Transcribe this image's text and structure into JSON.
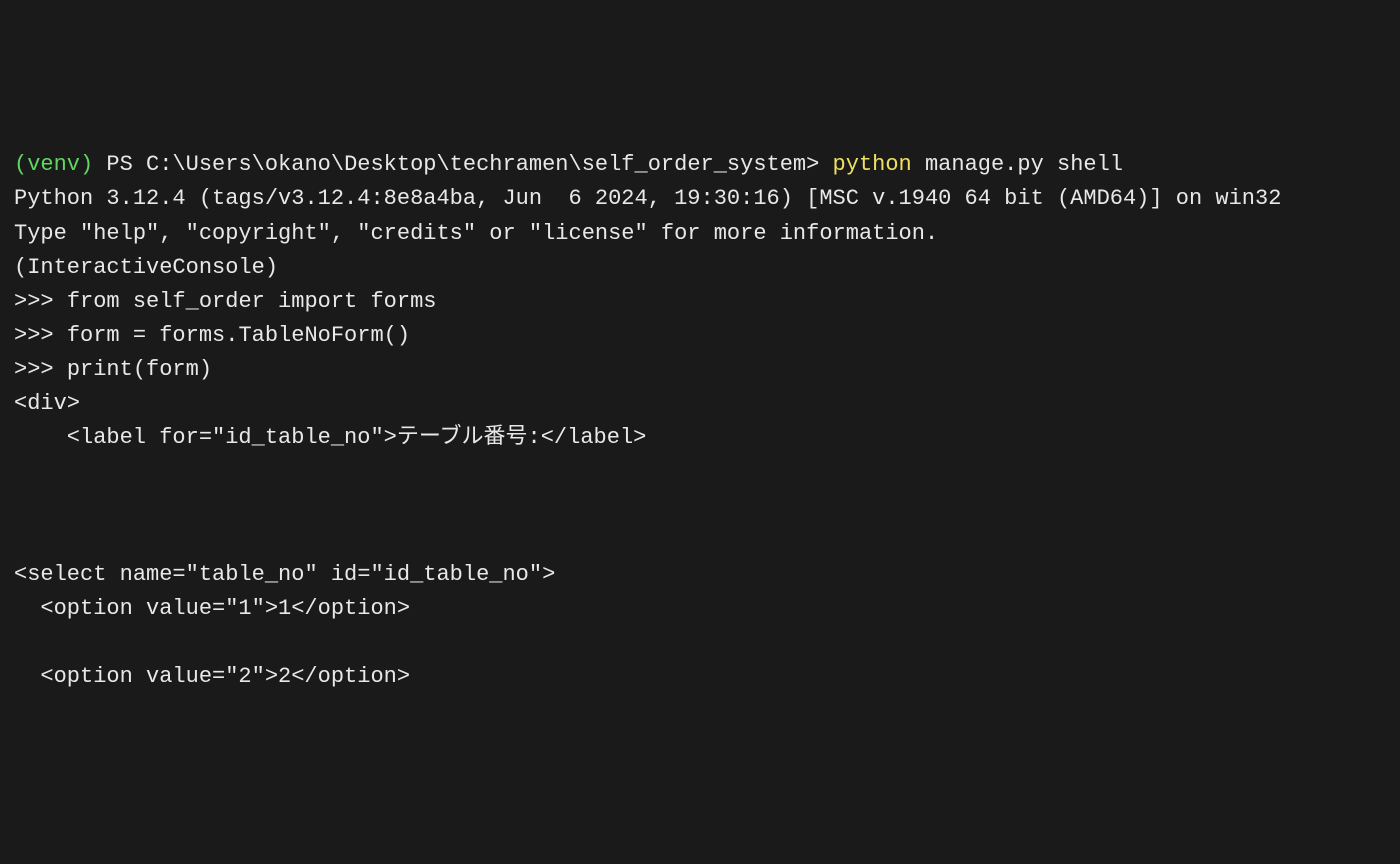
{
  "prompt": {
    "venv": "(venv)",
    "shell_prefix": " PS ",
    "path": "C:\\Users\\okano\\Desktop\\techramen\\self_order_system",
    "chevron": "> ",
    "command_py": "python",
    "command_args": " manage.py shell"
  },
  "header": {
    "python_version": "Python 3.12.4 (tags/v3.12.4:8e8a4ba, Jun  6 2024, 19:30:16) [MSC v.1940 64 bit (AMD64)] on win32",
    "help_line": "Type \"help\", \"copyright\", \"credits\" or \"license\" for more information.",
    "console": "(InteractiveConsole)"
  },
  "repl": {
    "p": ">>> ",
    "line1": "from self_order import forms",
    "line2": "form = forms.TableNoForm()",
    "line3": "print(form)"
  },
  "output": {
    "div_open": "<div>",
    "label": "<label for=\"id_table_no\">テーブル番号:</label>",
    "select_open": "<select name=\"table_no\" id=\"id_table_no\">",
    "option1": "<option value=\"1\">1</option>",
    "option2": "<option value=\"2\">2</option>"
  }
}
